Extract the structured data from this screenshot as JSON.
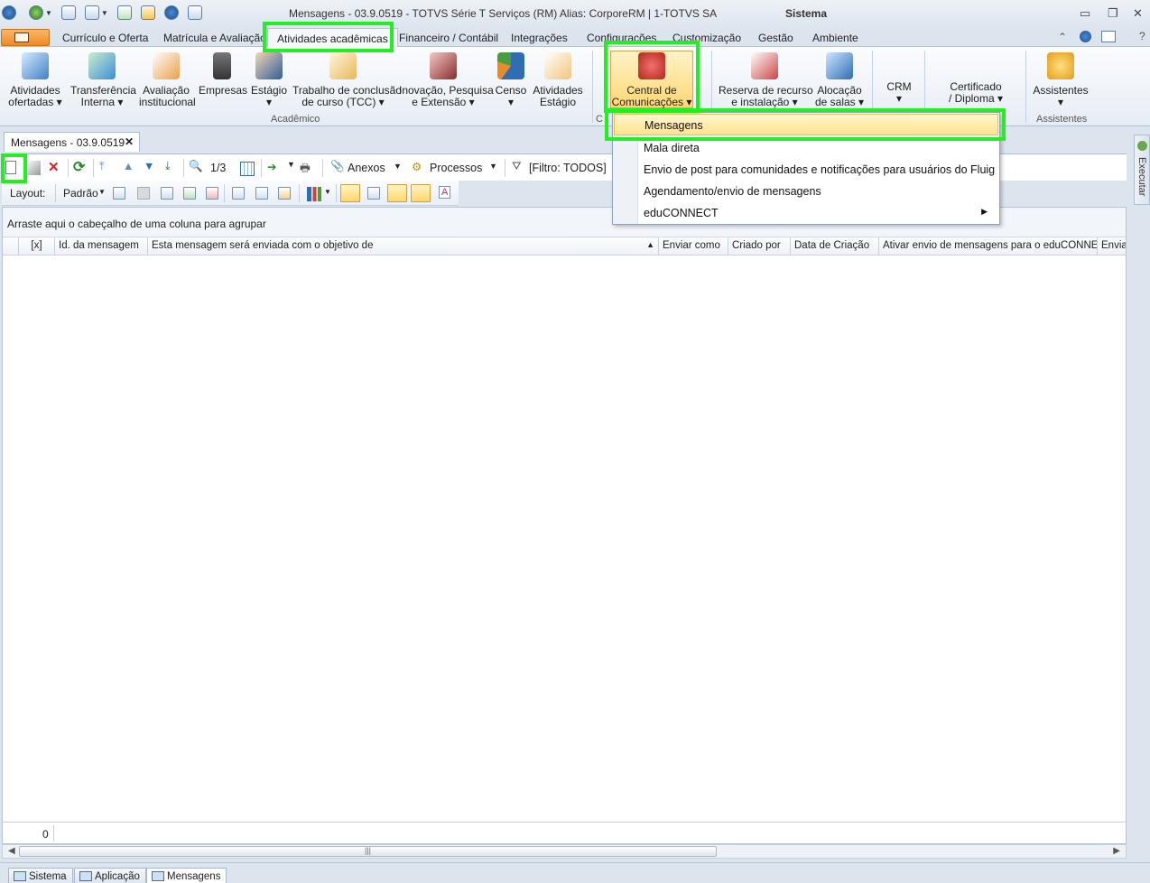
{
  "window": {
    "title": "Mensagens - 03.9.0519 - TOTVS Série T Serviços (RM) Alias: CorporeRM | 1-TOTVS SA",
    "context": "Sistema"
  },
  "menu_tabs": [
    "Currículo e Oferta",
    "Matrícula e Avaliação",
    "Atividades acadêmicas",
    "Financeiro / Contábil",
    "Integrações",
    "Configurações",
    "Customização",
    "Gestão",
    "Ambiente"
  ],
  "ribbon": {
    "buttons": [
      "Atividades\nofertadas ▾",
      "Transferência\nInterna ▾",
      "Avaliação\ninstitucional",
      "Empresas",
      "Estágio\n▾",
      "Trabalho de conclusão\nde curso (TCC) ▾",
      "Inovação, Pesquisa\ne Extensão ▾",
      "Censo\n▾",
      "Atividades\nEstágio",
      "Central de\nComunicações ▾",
      "Reserva de recurso\ne instalação ▾",
      "Alocação\nde salas ▾",
      "CRM\n▾",
      "Certificado\n/ Diploma ▾",
      "Assistentes\n▾"
    ],
    "groups": [
      "Acadêmico",
      "C",
      "Assistentes"
    ]
  },
  "document_tab": {
    "label": "Mensagens - 03.9.0519",
    "close": "✕"
  },
  "toolbar": {
    "record_nav": "1/3",
    "anexos": "Anexos",
    "processos": "Processos",
    "filter": "[Filtro: TODOS]",
    "layout_label": "Layout:",
    "layout_value": "Padrão"
  },
  "grid": {
    "group_hint": "Arraste aqui o cabeçalho de uma coluna para agrupar",
    "columns": [
      "[x]",
      "Id. da mensagem",
      "Esta mensagem será enviada com o objetivo de",
      "Enviar como",
      "Criado por",
      "Data de Criação",
      "Ativar envio de mensagens para o eduCONNECT",
      "Envia"
    ],
    "sort_indicator": "▲",
    "row_count": "0"
  },
  "side_panel": {
    "label": "Executar"
  },
  "taskbar": [
    "Sistema",
    "Aplicação",
    "Mensagens"
  ],
  "dropdown": {
    "items": [
      "Mensagens",
      "Mala direta",
      "Envio de post para comunidades e notificações para usuários do Fluig",
      "Agendamento/envio de mensagens",
      "eduCONNECT"
    ],
    "selected": "Mensagens"
  },
  "colors": {
    "highlight": "#22ee22",
    "selection": "#ffe38c",
    "app_button": "#ef8a24"
  }
}
